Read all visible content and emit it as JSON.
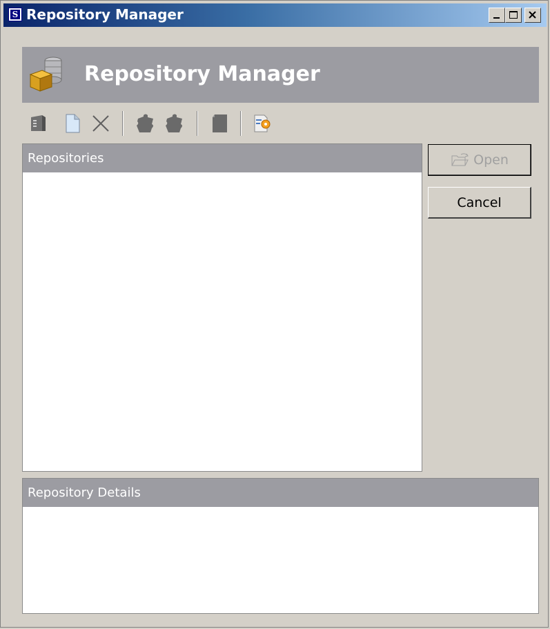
{
  "window": {
    "title": "Repository Manager"
  },
  "title_bar_buttons": [
    {
      "name": "minimize-button",
      "icon": "minimize-icon"
    },
    {
      "name": "maximize-button",
      "icon": "maximize-icon"
    },
    {
      "name": "close-button",
      "icon": "close-icon"
    }
  ],
  "banner": {
    "title": "Repository Manager",
    "icon": "repository-database-icon"
  },
  "toolbar": {
    "items": [
      {
        "name": "edit-repository-button",
        "icon": "edit-document-icon"
      },
      {
        "name": "new-repository-button",
        "icon": "new-document-icon"
      },
      {
        "name": "delete-repository-button",
        "icon": "delete-x-icon"
      },
      {
        "name": "import-repository-button",
        "icon": "import-puzzle-icon"
      },
      {
        "name": "export-repository-button",
        "icon": "export-puzzle-icon"
      },
      {
        "name": "copy-repository-button",
        "icon": "copy-document-icon"
      },
      {
        "name": "repository-settings-button",
        "icon": "settings-document-icon"
      }
    ]
  },
  "repositories": {
    "header": "Repositories",
    "items": []
  },
  "details": {
    "header": "Repository Details",
    "content": ""
  },
  "buttons": {
    "open_label": "Open",
    "cancel_label": "Cancel",
    "open_icon": "open-folder-icon"
  },
  "colors": {
    "titlebar_start": "#0a246a",
    "titlebar_end": "#a6caf0",
    "header_gray": "#9c9ca2",
    "window_bg": "#d4d0c8"
  }
}
